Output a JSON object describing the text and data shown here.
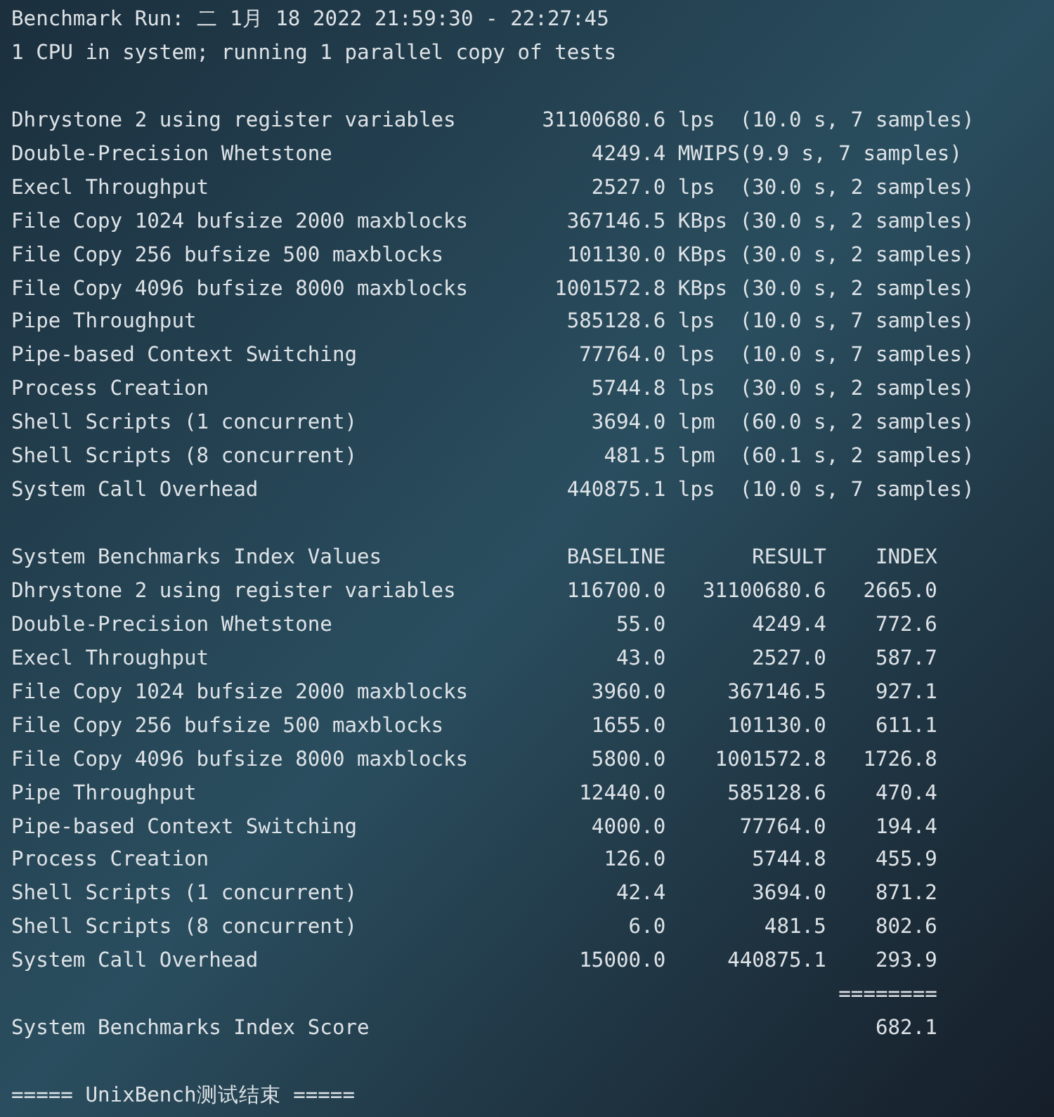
{
  "header_lines": [
    "Benchmark Run: 二 1月 18 2022 21:59:30 - 22:27:45",
    "1 CPU in system; running 1 parallel copy of tests"
  ],
  "results": [
    {
      "name": "Dhrystone 2 using register variables",
      "value": "31100680.6",
      "unit": "lps",
      "info": "(10.0 s, 7 samples)"
    },
    {
      "name": "Double-Precision Whetstone",
      "value": "4249.4",
      "unit": "MWIPS",
      "info": "(9.9 s, 7 samples)"
    },
    {
      "name": "Execl Throughput",
      "value": "2527.0",
      "unit": "lps",
      "info": "(30.0 s, 2 samples)"
    },
    {
      "name": "File Copy 1024 bufsize 2000 maxblocks",
      "value": "367146.5",
      "unit": "KBps",
      "info": "(30.0 s, 2 samples)"
    },
    {
      "name": "File Copy 256 bufsize 500 maxblocks",
      "value": "101130.0",
      "unit": "KBps",
      "info": "(30.0 s, 2 samples)"
    },
    {
      "name": "File Copy 4096 bufsize 8000 maxblocks",
      "value": "1001572.8",
      "unit": "KBps",
      "info": "(30.0 s, 2 samples)"
    },
    {
      "name": "Pipe Throughput",
      "value": "585128.6",
      "unit": "lps",
      "info": "(10.0 s, 7 samples)"
    },
    {
      "name": "Pipe-based Context Switching",
      "value": "77764.0",
      "unit": "lps",
      "info": "(10.0 s, 7 samples)"
    },
    {
      "name": "Process Creation",
      "value": "5744.8",
      "unit": "lps",
      "info": "(30.0 s, 2 samples)"
    },
    {
      "name": "Shell Scripts (1 concurrent)",
      "value": "3694.0",
      "unit": "lpm",
      "info": "(60.0 s, 2 samples)"
    },
    {
      "name": "Shell Scripts (8 concurrent)",
      "value": "481.5",
      "unit": "lpm",
      "info": "(60.1 s, 2 samples)"
    },
    {
      "name": "System Call Overhead",
      "value": "440875.1",
      "unit": "lps",
      "info": "(10.0 s, 7 samples)"
    }
  ],
  "index_table": {
    "columns": [
      "System Benchmarks Index Values",
      "BASELINE",
      "RESULT",
      "INDEX"
    ],
    "rows": [
      {
        "name": "Dhrystone 2 using register variables",
        "baseline": "116700.0",
        "result": "31100680.6",
        "index": "2665.0"
      },
      {
        "name": "Double-Precision Whetstone",
        "baseline": "55.0",
        "result": "4249.4",
        "index": "772.6"
      },
      {
        "name": "Execl Throughput",
        "baseline": "43.0",
        "result": "2527.0",
        "index": "587.7"
      },
      {
        "name": "File Copy 1024 bufsize 2000 maxblocks",
        "baseline": "3960.0",
        "result": "367146.5",
        "index": "927.1"
      },
      {
        "name": "File Copy 256 bufsize 500 maxblocks",
        "baseline": "1655.0",
        "result": "101130.0",
        "index": "611.1"
      },
      {
        "name": "File Copy 4096 bufsize 8000 maxblocks",
        "baseline": "5800.0",
        "result": "1001572.8",
        "index": "1726.8"
      },
      {
        "name": "Pipe Throughput",
        "baseline": "12440.0",
        "result": "585128.6",
        "index": "470.4"
      },
      {
        "name": "Pipe-based Context Switching",
        "baseline": "4000.0",
        "result": "77764.0",
        "index": "194.4"
      },
      {
        "name": "Process Creation",
        "baseline": "126.0",
        "result": "5744.8",
        "index": "455.9"
      },
      {
        "name": "Shell Scripts (1 concurrent)",
        "baseline": "42.4",
        "result": "3694.0",
        "index": "871.2"
      },
      {
        "name": "Shell Scripts (8 concurrent)",
        "baseline": "6.0",
        "result": "481.5",
        "index": "802.6"
      },
      {
        "name": "System Call Overhead",
        "baseline": "15000.0",
        "result": "440875.1",
        "index": "293.9"
      }
    ],
    "separator": "========",
    "score": {
      "label": "System Benchmarks Index Score",
      "value": "682.1"
    }
  },
  "footer": "===== UnixBench测试结束 ====="
}
